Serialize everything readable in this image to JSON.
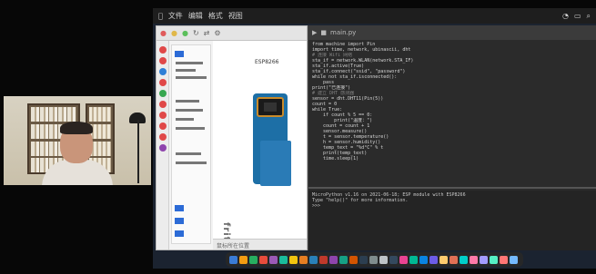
{
  "screen": {
    "menubar": {
      "items": [
        "",
        "文件",
        "编辑",
        "格式",
        "视图"
      ],
      "right_items": []
    }
  },
  "fritzing": {
    "canvas_label": "ESP8266",
    "logo_text": "fritzing",
    "status_text": "鼠标所在位置"
  },
  "editor": {
    "tab_label": "main.py",
    "code_lines": [
      "from machine import Pin",
      "import time, network, ubinascii, dht",
      "",
      "# 连接 Wifi 网络",
      "sta_if = network.WLAN(network.STA_IF)",
      "sta_if.active(True)",
      "sta_if.connect(\"ssid\", \"password\")",
      "while not sta_if.isconnected():",
      "    pass",
      "print(\"已连接\")",
      "",
      "# 建立 DHT 感测器",
      "sensor = dht.DHT11(Pin(5))",
      "",
      "count = 0",
      "while True:",
      "    if count % 5 == 0:",
      "        print(\"温度：\")",
      "    count = count + 1",
      "",
      "    sensor.measure()",
      "    t = sensor.temperature()",
      "    h = sensor.humidity()",
      "    temp_text = \"%d°C\" % t",
      "    print(temp_text)",
      "    time.sleep(1)"
    ],
    "shell_lines": [
      "MicroPython v1.16 on 2021-06-18; ESP module with ESP8266",
      "Type \"help()\" for more information.",
      ">>>"
    ]
  },
  "dock": {
    "icon_colors": [
      "#3a7bd5",
      "#f39c12",
      "#27ae60",
      "#e74c3c",
      "#9b59b6",
      "#1abc9c",
      "#f1c40f",
      "#e67e22",
      "#2980b9",
      "#c0392b",
      "#8e44ad",
      "#16a085",
      "#d35400",
      "#2c3e50",
      "#7f8c8d",
      "#bdc3c7",
      "#34495e",
      "#e84393",
      "#00b894",
      "#0984e3",
      "#6c5ce7",
      "#fdcb6e",
      "#e17055",
      "#00cec9",
      "#fd79a8",
      "#a29bfe",
      "#55efc4",
      "#ff7675",
      "#74b9ff"
    ]
  }
}
